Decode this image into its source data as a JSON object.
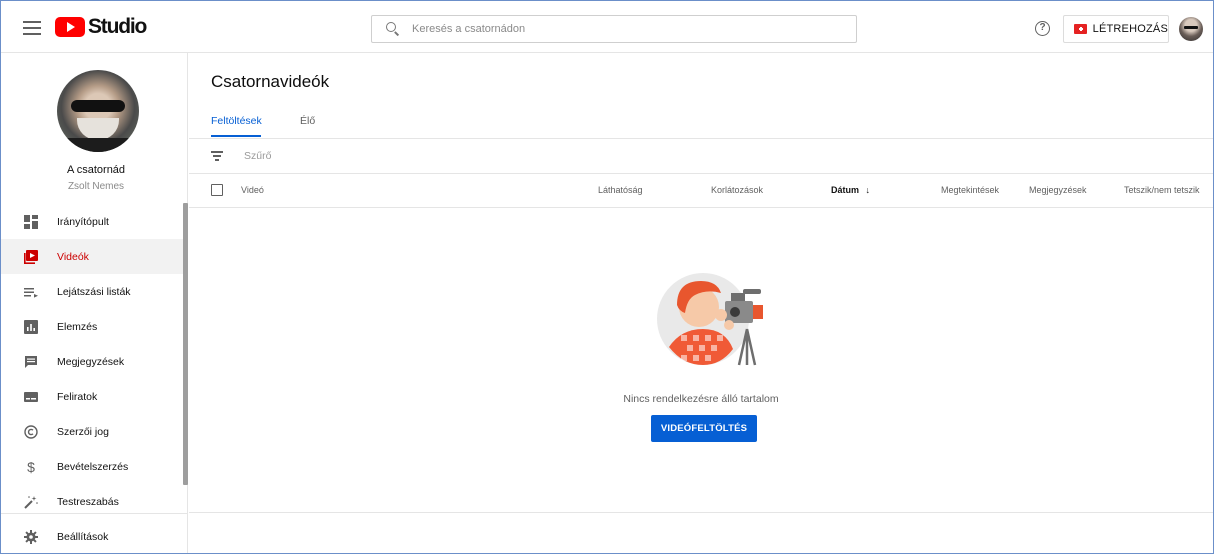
{
  "header": {
    "logo_text": "Studio",
    "search_placeholder": "Keresés a csatornádon",
    "help_label": "?",
    "create_label": "LÉTREHOZÁS"
  },
  "sidebar": {
    "channel_title": "A csatornád",
    "channel_name": "Zsolt Nemes",
    "items": [
      {
        "label": "Irányítópult",
        "icon": "dashboard-icon",
        "active": false
      },
      {
        "label": "Videók",
        "icon": "videos-icon",
        "active": true
      },
      {
        "label": "Lejátszási listák",
        "icon": "playlists-icon",
        "active": false
      },
      {
        "label": "Elemzés",
        "icon": "analytics-icon",
        "active": false
      },
      {
        "label": "Megjegyzések",
        "icon": "comments-icon",
        "active": false
      },
      {
        "label": "Feliratok",
        "icon": "subtitles-icon",
        "active": false
      },
      {
        "label": "Szerzői jog",
        "icon": "copyright-icon",
        "active": false
      },
      {
        "label": "Bevételszerzés",
        "icon": "monetization-icon",
        "active": false
      },
      {
        "label": "Testreszabás",
        "icon": "customization-icon",
        "active": false
      }
    ],
    "settings_label": "Beállítások"
  },
  "main": {
    "title": "Csatornavideók",
    "tabs": [
      {
        "label": "Feltöltések",
        "active": true
      },
      {
        "label": "Élő",
        "active": false
      }
    ],
    "filter_label": "Szűrő",
    "columns": {
      "video": "Videó",
      "visibility": "Láthatóság",
      "restrictions": "Korlátozások",
      "date": "Dátum",
      "views": "Megtekintések",
      "comments": "Megjegyzések",
      "likes": "Tetszik/nem tetszik"
    },
    "empty_text": "Nincs rendelkezésre álló tartalom",
    "upload_button": "VIDEÓFELTÖLTÉS"
  },
  "colors": {
    "accent_blue": "#065fd4",
    "brand_red": "#ff0000",
    "active_red": "#cc0000"
  }
}
